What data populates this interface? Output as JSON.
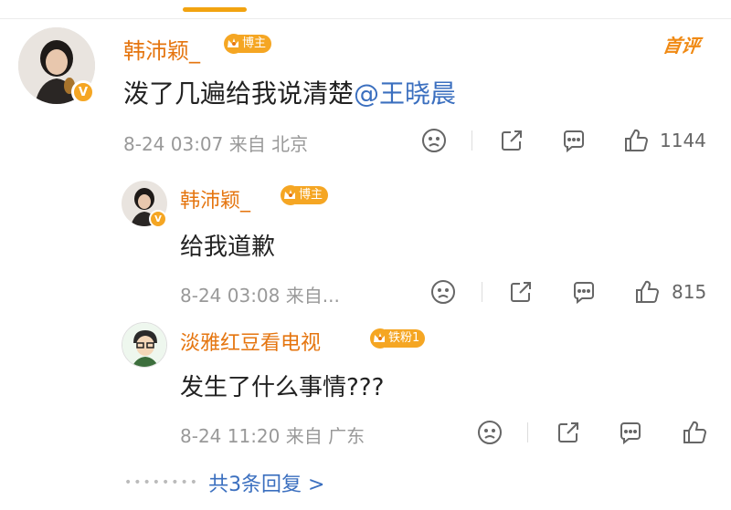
{
  "top_comment_label": "首评",
  "comments": [
    {
      "username": "韩沛颖_",
      "badge": "博主",
      "text": "泼了几遍给我说清楚",
      "mention": "@王晓晨",
      "meta": "8-24 03:07 来自 北京",
      "likes": "1144"
    }
  ],
  "replies": [
    {
      "username": "韩沛颖_",
      "badge": "博主",
      "text": "给我道歉",
      "meta": "8-24 03:08 来自...",
      "likes": "815"
    },
    {
      "username": "淡雅红豆看电视",
      "badge": "铁粉1",
      "text": "发生了什么事情???",
      "meta": "8-24 11:20 来自 广东",
      "likes": ""
    }
  ],
  "more_replies": "共3条回复 >",
  "colors": {
    "accent": "#f5a623",
    "username": "#e5750f",
    "link": "#3b6fbf",
    "meta": "#999999"
  },
  "icons": [
    "dislike-face-icon",
    "share-icon",
    "comment-icon",
    "thumbs-up-icon",
    "verified-v-icon",
    "crown-icon"
  ]
}
